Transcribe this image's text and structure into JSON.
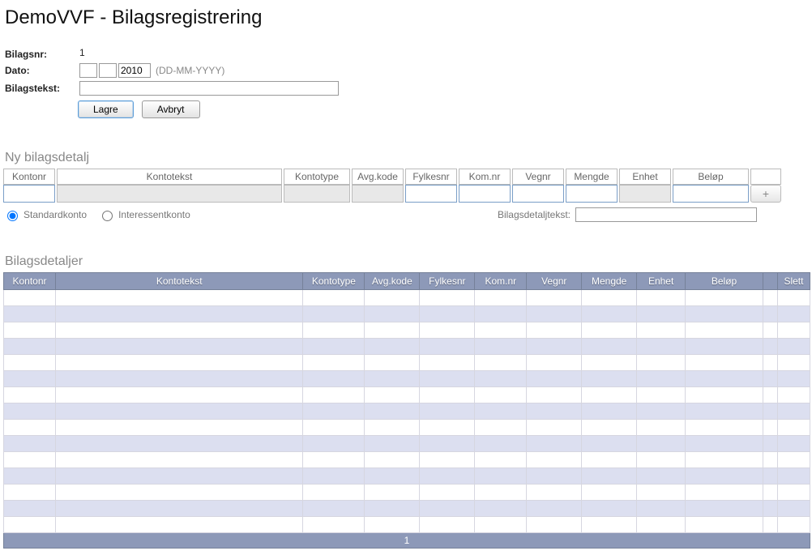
{
  "page": {
    "title": "DemoVVF - Bilagsregistrering"
  },
  "header": {
    "bilagsnr_label": "Bilagsnr:",
    "bilagsnr_value": "1",
    "dato_label": "Dato:",
    "dd": "",
    "mm": "",
    "yyyy": "2010",
    "dato_hint": "(DD-MM-YYYY)",
    "bilagstekst_label": "Bilagstekst:",
    "bilagstekst_value": "",
    "lagre_label": "Lagre",
    "avbryt_label": "Avbryt"
  },
  "entry": {
    "section_title": "Ny bilagsdetalj",
    "headers": {
      "kontonr": "Kontonr",
      "kontotekst": "Kontotekst",
      "kontotype": "Kontotype",
      "avg": "Avg.kode",
      "fylkes": "Fylkesnr",
      "kom": "Kom.nr",
      "veg": "Vegnr",
      "mengde": "Mengde",
      "enhet": "Enhet",
      "belop": "Beløp"
    },
    "add_label": "+",
    "radio_standard": "Standardkonto",
    "radio_interessent": "Interessentkonto",
    "detailtext_label": "Bilagsdetaljtekst:",
    "detailtext_value": ""
  },
  "table": {
    "section_title": "Bilagsdetaljer",
    "headers": {
      "kontonr": "Kontonr",
      "kontotekst": "Kontotekst",
      "kontotype": "Kontotype",
      "avg": "Avg.kode",
      "fylkes": "Fylkesnr",
      "kom": "Kom.nr",
      "veg": "Vegnr",
      "mengde": "Mengde",
      "enhet": "Enhet",
      "belop": "Beløp",
      "slett": "Slett"
    },
    "empty_row_count": 15,
    "pager_current": "1"
  }
}
